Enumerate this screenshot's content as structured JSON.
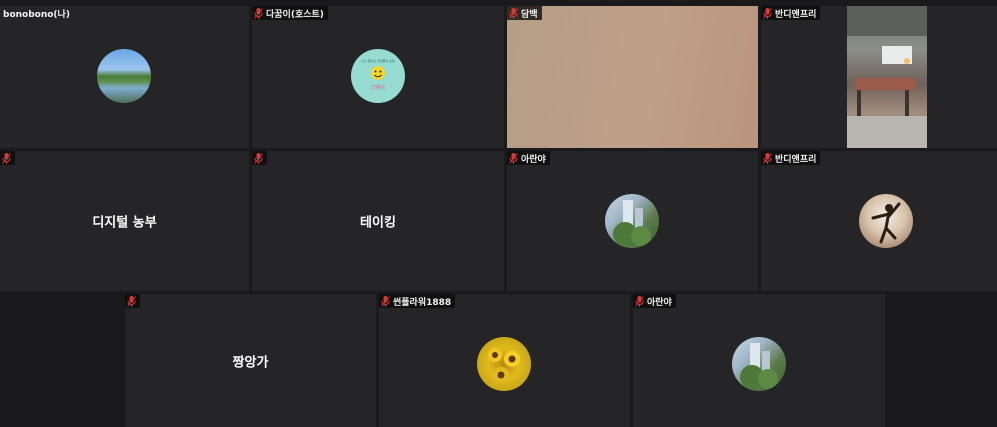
{
  "participants": [
    {
      "id": "t1",
      "name": "bonobono(나)",
      "show_mic": false,
      "avatar": "lake-photo"
    },
    {
      "id": "t2",
      "name": "다꿈이(호스트)",
      "show_mic": true,
      "avatar": "smiley-logo",
      "avatar_text": {
        "line": "다시 꿈꾸는 청년들의 모임",
        "brand": "다꿈이"
      }
    },
    {
      "id": "t3",
      "name": "담백",
      "show_mic": true,
      "video": "beige-camera-feed"
    },
    {
      "id": "t4",
      "name": "반디앤프리",
      "show_mic": true,
      "video": "office-room-feed"
    },
    {
      "id": "t5",
      "name": "",
      "show_mic": true,
      "display_name": "디지털 농부"
    },
    {
      "id": "t6",
      "name": "",
      "show_mic": true,
      "display_name": "테이킹"
    },
    {
      "id": "t7",
      "name": "아란야",
      "show_mic": true,
      "avatar": "building-photo"
    },
    {
      "id": "t8",
      "name": "반디앤프리",
      "show_mic": true,
      "avatar": "yoga-photo"
    },
    {
      "id": "t9",
      "name": "",
      "show_mic": true,
      "display_name": "짱앙가"
    },
    {
      "id": "t10",
      "name": "썬플라워1888",
      "show_mic": true,
      "avatar": "sunflower-photo"
    },
    {
      "id": "t11",
      "name": "아란야",
      "show_mic": true,
      "avatar": "building-photo"
    }
  ],
  "colors": {
    "background": "#1a1a1c",
    "tile": "#252528",
    "mic_muted": "#d43b3b"
  }
}
